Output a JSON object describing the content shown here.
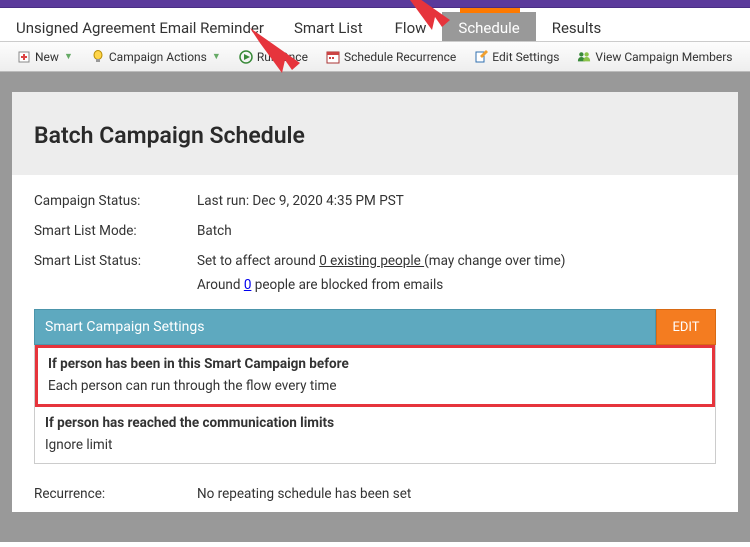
{
  "crumb": "Unsigned Agreement Email Reminder",
  "tabs": [
    {
      "label": "Smart List",
      "active": false
    },
    {
      "label": "Flow",
      "active": false
    },
    {
      "label": "Schedule",
      "active": true
    },
    {
      "label": "Results",
      "active": false
    }
  ],
  "toolbar": {
    "new": "New",
    "actions": "Campaign Actions",
    "run_once": "Run Once",
    "schedule_recurrence": "Schedule Recurrence",
    "edit_settings": "Edit Settings",
    "view_members": "View Campaign Members"
  },
  "page_title": "Batch Campaign Schedule",
  "status": {
    "label": "Campaign Status:",
    "value": "Last run: Dec 9, 2020 4:35 PM PST"
  },
  "mode": {
    "label": "Smart List Mode:",
    "value": "Batch"
  },
  "sl_status": {
    "label": "Smart List Status:",
    "prefix": "Set to affect around ",
    "link": "0 existing people ",
    "suffix": "(may change over time)"
  },
  "blocked": {
    "prefix": "Around ",
    "link": "0",
    "suffix": " people are blocked from emails"
  },
  "settings": {
    "header": "Smart Campaign Settings",
    "edit": "EDIT",
    "rule1_title": "If person has been in this Smart Campaign before",
    "rule1_value": "Each person can run through the flow every time",
    "rule2_title": "If person has reached the communication limits",
    "rule2_value": "Ignore limit"
  },
  "recurrence": {
    "label": "Recurrence:",
    "value": "No repeating schedule has been set"
  }
}
